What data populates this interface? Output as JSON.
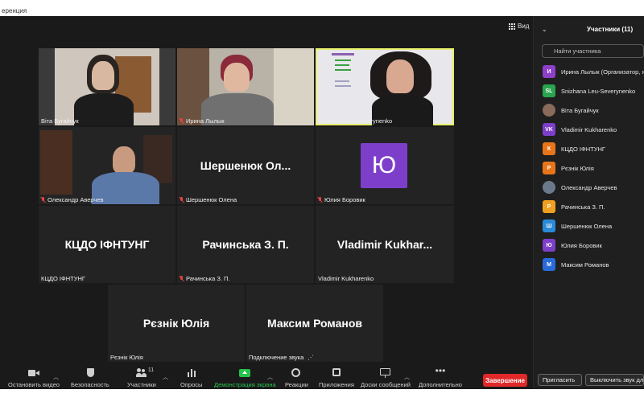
{
  "window": {
    "title": "еренция"
  },
  "view_button": {
    "label": "Вид"
  },
  "tiles": [
    {
      "name": "Віта Бугайчук",
      "muted": false,
      "type": "video"
    },
    {
      "name": "Ирина Лылык",
      "muted": true,
      "type": "video"
    },
    {
      "name": "Snizhana Leu-Severynenko",
      "muted": false,
      "type": "video",
      "active": true
    },
    {
      "name": "Олександр Аверчев",
      "muted": true,
      "type": "video"
    },
    {
      "name": "Шершенюк Олена",
      "muted": true,
      "type": "name",
      "display": "Шершенюк  Ол..."
    },
    {
      "name": "Юлия Боровик",
      "muted": true,
      "type": "avatar",
      "letter": "Ю"
    },
    {
      "name": "КЦДО ІФНТУНГ",
      "muted": false,
      "type": "name",
      "display": "КЦДО ІФНТУНГ"
    },
    {
      "name": "Рачинська З. П.",
      "muted": true,
      "type": "name",
      "display": "Рачинська З. П."
    },
    {
      "name": "Vladimir Kukharenko",
      "muted": false,
      "type": "name",
      "display": "Vladimir  Kukhar..."
    },
    {
      "name": "Рєзнік Юлія",
      "muted": false,
      "type": "name",
      "display": "Рєзнік Юлія"
    },
    {
      "name": "Подключение звука",
      "muted": false,
      "type": "name",
      "display": "Максим Романов"
    }
  ],
  "toolbar": {
    "stop_video": "Остановить видео",
    "security": "Безопасность",
    "participants": "Участники",
    "participants_count": "11",
    "polls": "Опросы",
    "share_screen": "Демонстрация экрана",
    "reactions": "Реакции",
    "apps": "Приложения",
    "whiteboards": "Доски сообщений",
    "more": "Дополнительно",
    "end": "Завершение"
  },
  "panel": {
    "title": "Участники (11)",
    "search_placeholder": "Найти участника",
    "participants": [
      {
        "initials": "И",
        "color": "#8e3fc9",
        "name": "Ирина Лылык (Организатор, я)"
      },
      {
        "initials": "SL",
        "color": "#2aa44f",
        "name": "Snizhana Leu-Severynenko"
      },
      {
        "initials": "",
        "color": "#8a6a5a",
        "name": "Віта Бугайчук",
        "photo": true
      },
      {
        "initials": "VK",
        "color": "#7d3fc9",
        "name": "Vladimir Kukharenko"
      },
      {
        "initials": "К",
        "color": "#e8751a",
        "name": "КЦДО ІФНТУНГ"
      },
      {
        "initials": "Р",
        "color": "#e8751a",
        "name": "Рєзнік Юлія"
      },
      {
        "initials": "",
        "color": "#6a7a8a",
        "name": "Олександр Аверчев",
        "photo": true
      },
      {
        "initials": "Р",
        "color": "#f0a020",
        "name": "Рачинська З. П."
      },
      {
        "initials": "Ш",
        "color": "#2a8ad8",
        "name": "Шершенюк Олена"
      },
      {
        "initials": "Ю",
        "color": "#7d3fc9",
        "name": "Юлия Боровик"
      },
      {
        "initials": "М",
        "color": "#2a6ad8",
        "name": "Максим Романов"
      }
    ],
    "invite": "Пригласить",
    "unmute_all": "Выключить звук для всех"
  }
}
